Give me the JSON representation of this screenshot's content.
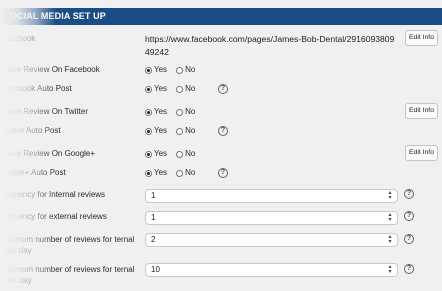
{
  "section": {
    "title": "OCIAL MEDIA SET UP"
  },
  "facebook": {
    "label": "acebook",
    "url": "https://www.facebook.com/pages/James-Bob-Dental/291609380949242",
    "edit_label": "Edit Info"
  },
  "share_facebook": {
    "label": "hare Review On Facebook",
    "yes_label": "Yes",
    "no_label": "No",
    "selected": "Yes"
  },
  "facebook_auto_post": {
    "label": "acebook Auto Post",
    "yes_label": "Yes",
    "no_label": "No",
    "selected": "Yes"
  },
  "share_twitter": {
    "label": "hare Review On Twitter",
    "yes_label": "Yes",
    "no_label": "No",
    "selected": "Yes",
    "edit_label": "Edit Info"
  },
  "twitter_auto_post": {
    "label": "witter Auto Post",
    "yes_label": "Yes",
    "no_label": "No",
    "selected": "Yes"
  },
  "share_google": {
    "label": "hare Review On Google+",
    "yes_label": "Yes",
    "no_label": "No",
    "selected": "Yes",
    "edit_label": "Edit Info"
  },
  "google_auto_post": {
    "label": "oogle+ Auto Post",
    "yes_label": "Yes",
    "no_label": "No",
    "selected": "Yes"
  },
  "freq_internal": {
    "label": "equency for Internal reviews",
    "value": "1"
  },
  "freq_external": {
    "label": "equency for external reviews",
    "value": "1"
  },
  "max_internal": {
    "label": "aximum number of reviews for ternal per day",
    "value": "2"
  },
  "max_external": {
    "label": "aximum number of reviews for ternal per day",
    "value": "10"
  },
  "help_symbol": "?",
  "select_arrows": "⌃⌄"
}
